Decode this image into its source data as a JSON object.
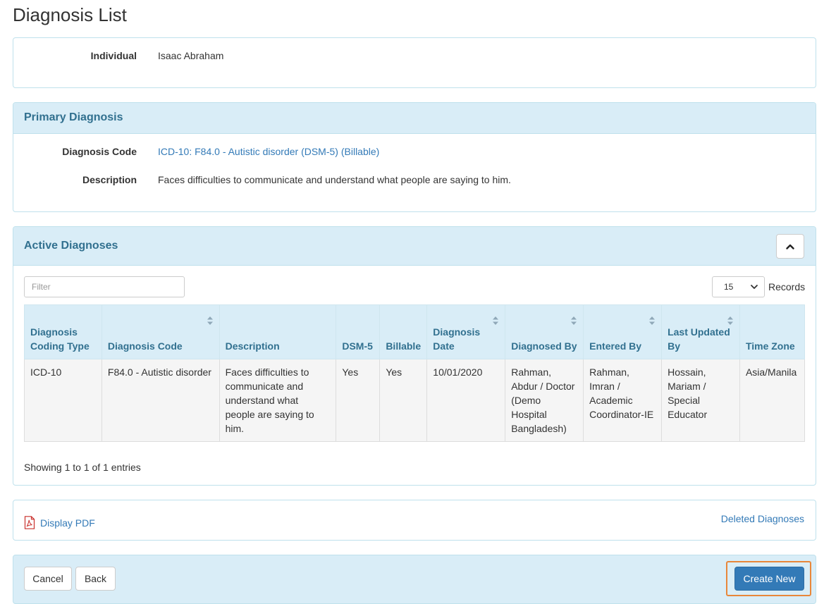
{
  "page": {
    "title": "Diagnosis List"
  },
  "individual": {
    "label": "Individual",
    "value": "Isaac Abraham"
  },
  "primary": {
    "heading": "Primary Diagnosis",
    "code_label": "Diagnosis Code",
    "code_value": "ICD-10: F84.0 - Autistic disorder (DSM-5) (Billable)",
    "desc_label": "Description",
    "desc_value": "Faces difficulties to communicate and understand what people are saying to him."
  },
  "active": {
    "heading": "Active Diagnoses",
    "filter_placeholder": "Filter",
    "records_value": "15",
    "records_label": "Records",
    "columns": [
      "Diagnosis Coding Type",
      "Diagnosis Code",
      "Description",
      "DSM-5",
      "Billable",
      "Diagnosis Date",
      "Diagnosed By",
      "Entered By",
      "Last Updated By",
      "Time Zone"
    ],
    "rows": [
      {
        "coding_type": "ICD-10",
        "code": "F84.0 - Autistic disorder",
        "description": "Faces difficulties to communicate and understand what people are saying to him.",
        "dsm5": "Yes",
        "billable": "Yes",
        "date": "10/01/2020",
        "diagnosed_by": "Rahman, Abdur / Doctor (Demo Hospital Bangladesh)",
        "entered_by": "Rahman, Imran / Academic Coordinator-IE",
        "updated_by": "Hossain, Mariam / Special Educator",
        "time_zone": "Asia/Manila"
      }
    ],
    "entries_info": "Showing 1 to 1 of 1 entries"
  },
  "links": {
    "pdf": "Display PDF",
    "deleted": "Deleted Diagnoses"
  },
  "footer": {
    "cancel": "Cancel",
    "back": "Back",
    "create": "Create New"
  },
  "colors": {
    "heading_bg": "#d9edf7",
    "heading_text": "#31708f",
    "link": "#337ab7",
    "primary_btn": "#337ab7",
    "highlight": "#e8873a"
  }
}
